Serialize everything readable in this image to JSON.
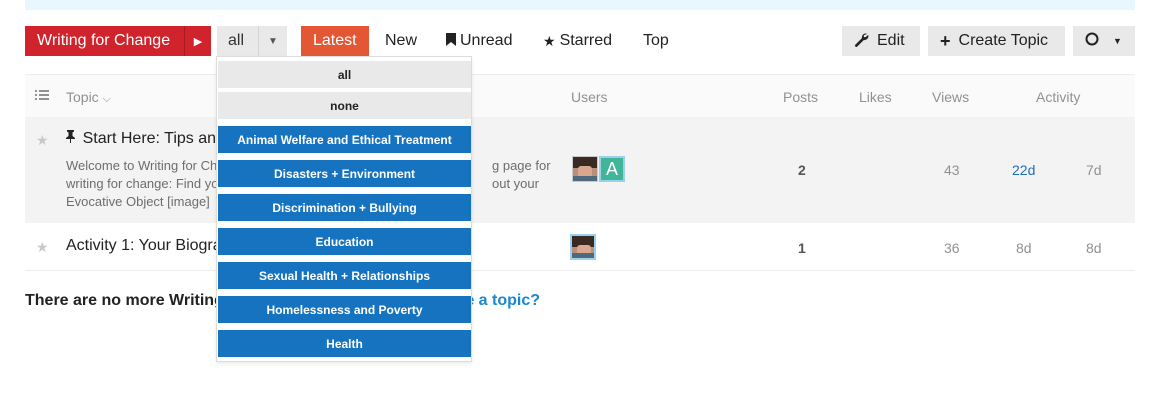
{
  "nav": {
    "category_label": "Writing for Change",
    "filter_label": "all",
    "tabs": [
      {
        "label": "Latest"
      },
      {
        "label": "New"
      },
      {
        "label": "Unread"
      },
      {
        "label": "Starred"
      },
      {
        "label": "Top"
      }
    ],
    "edit_label": "Edit",
    "create_topic_label": "Create Topic"
  },
  "table": {
    "headers": {
      "topic": "Topic",
      "users": "Users",
      "posts": "Posts",
      "likes": "Likes",
      "views": "Views",
      "activity": "Activity"
    },
    "rows": [
      {
        "title": "Start Here: Tips an",
        "excerpt_line1": "Welcome to Writing for Ch",
        "excerpt_line2": "writing for change: Find yo",
        "excerpt_line3": "Evocative Object [image]",
        "excerpt_right1": "g page for",
        "excerpt_right2": "out your",
        "user_letter": "A",
        "posts": "2",
        "views": "43",
        "first_post": "22d",
        "last_post": "7d"
      },
      {
        "title": "Activity 1: Your Biogra",
        "posts": "1",
        "views": "36",
        "first_post": "8d",
        "last_post": "8d"
      }
    ]
  },
  "footer": {
    "text": "There are no more Writing",
    "link": "te a topic?"
  },
  "dropdown": {
    "items": [
      {
        "label": "all"
      },
      {
        "label": "none"
      },
      {
        "label": "Animal Welfare and Ethical Treatment"
      },
      {
        "label": "Disasters + Environment"
      },
      {
        "label": "Discrimination + Bullying"
      },
      {
        "label": "Education"
      },
      {
        "label": "Sexual Health + Relationships"
      },
      {
        "label": "Homelessness and Poverty"
      },
      {
        "label": "Health"
      }
    ]
  },
  "colors": {
    "category": "#d0232b",
    "active_tab": "#e45735",
    "dropdown_category": "#1673bf",
    "link": "#1a87ce"
  }
}
